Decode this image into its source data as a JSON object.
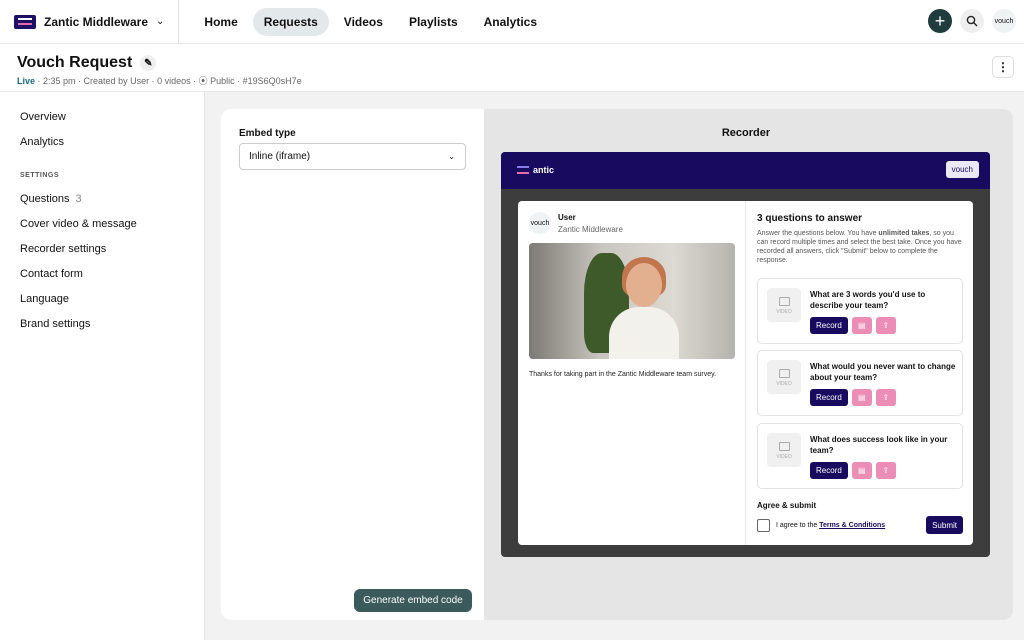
{
  "topbar": {
    "brand": "Zantic Middleware",
    "nav": [
      {
        "label": "Home"
      },
      {
        "label": "Requests"
      },
      {
        "label": "Videos"
      },
      {
        "label": "Playlists"
      },
      {
        "label": "Analytics"
      }
    ],
    "avatar": "vouch"
  },
  "header": {
    "title": "Vouch Request",
    "status": "Live",
    "meta": "· 2:35 pm · Created by User · 0 videos · ⦿ Public · #19S6Q0sH7e"
  },
  "sidebar": {
    "top_items": [
      {
        "label": "Overview"
      },
      {
        "label": "Analytics"
      }
    ],
    "section": "SETTINGS",
    "items": [
      {
        "label": "Questions",
        "count": "3"
      },
      {
        "label": "Cover video & message"
      },
      {
        "label": "Recorder settings"
      },
      {
        "label": "Contact form"
      },
      {
        "label": "Language"
      },
      {
        "label": "Brand settings"
      }
    ]
  },
  "embed": {
    "label": "Embed type",
    "selected": "Inline (iframe)",
    "button": "Generate embed code"
  },
  "recorder": {
    "title": "Recorder",
    "logo": "antic",
    "badge": "vouch",
    "host_avatar": "vouch",
    "host_name": "User",
    "host_org": "Zantic Middleware",
    "message": "Thanks for taking part in the Zantic Middleware team survey.",
    "questions_title": "3 questions to answer",
    "desc_1": "Answer the questions below. You have ",
    "desc_bold": "unlimited takes",
    "desc_2": ", so you can record multiple times and select the best take. Once you have recorded all answers, click \"Submit\" below to complete the response.",
    "video_label": "VIDEO",
    "record_label": "Record",
    "questions": [
      {
        "text": "What are 3 words you'd use to describe your team?"
      },
      {
        "text": "What would you never want to change about your team?"
      },
      {
        "text": "What does success look like in your team?"
      }
    ],
    "agree_title": "Agree & submit",
    "agree_text": "I agree to the ",
    "terms": "Terms & Conditions",
    "submit": "Submit"
  }
}
